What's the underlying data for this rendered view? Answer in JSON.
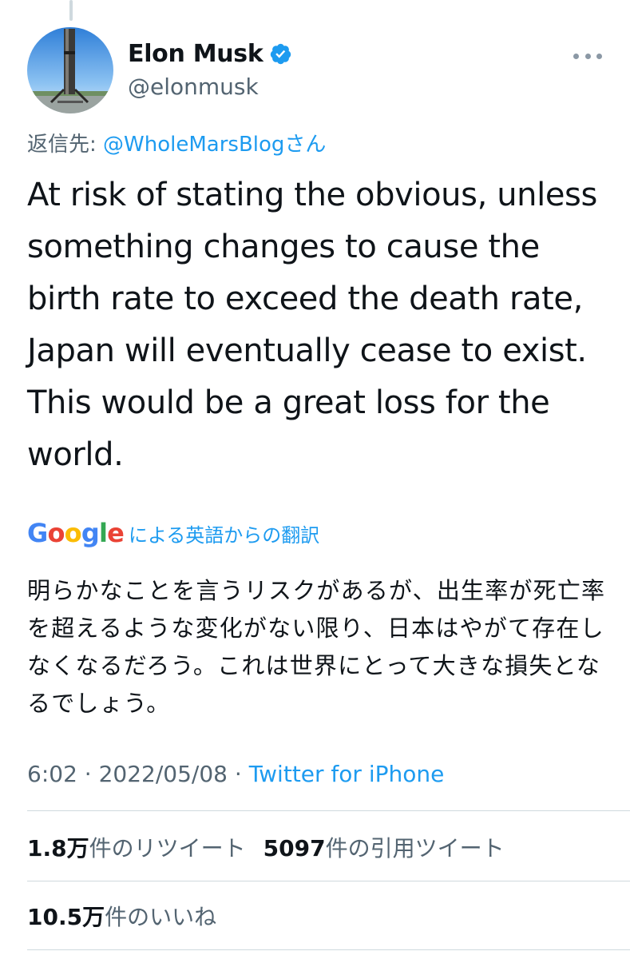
{
  "tweet": {
    "author": {
      "display_name": "Elon Musk",
      "handle": "@elonmusk",
      "verified": true,
      "avatar": "rocket-booster-photo"
    },
    "replying_to": {
      "prefix": "返信先: ",
      "mention": "@WholeMarsBlog",
      "suffix": "さん"
    },
    "text": "At risk of stating the obvious, unless something changes to cause the birth rate to exceed the death rate, Japan will eventually cease to exist. This would be a great loss for the world.",
    "translation": {
      "provider_logo": [
        "G",
        "o",
        "o",
        "g",
        "l",
        "e"
      ],
      "label": "による英語からの翻訳",
      "text": "明らかなことを言うリスクがあるが、出生率が死亡率を超えるような変化がない限り、日本はやがて存在しなくなるだろう。これは世界にとって大きな損失となるでしょう。"
    },
    "meta": {
      "time": "6:02",
      "separator": " · ",
      "date": "2022/05/08",
      "source": "Twitter for iPhone"
    },
    "stats": {
      "retweets_value": "1.8",
      "retweets_unit": "万",
      "retweets_label": "件のリツイート",
      "quotes_value": "5097",
      "quotes_label": "件の引用ツイート",
      "likes_value": "10.5",
      "likes_unit": "万",
      "likes_label": "件のいいね"
    }
  },
  "colors": {
    "link": "#1d9bf0",
    "secondary_text": "#536471",
    "primary_text": "#0f1419",
    "divider": "#cfd9de"
  },
  "icons": [
    "verified-badge-icon",
    "more-options-icon"
  ]
}
